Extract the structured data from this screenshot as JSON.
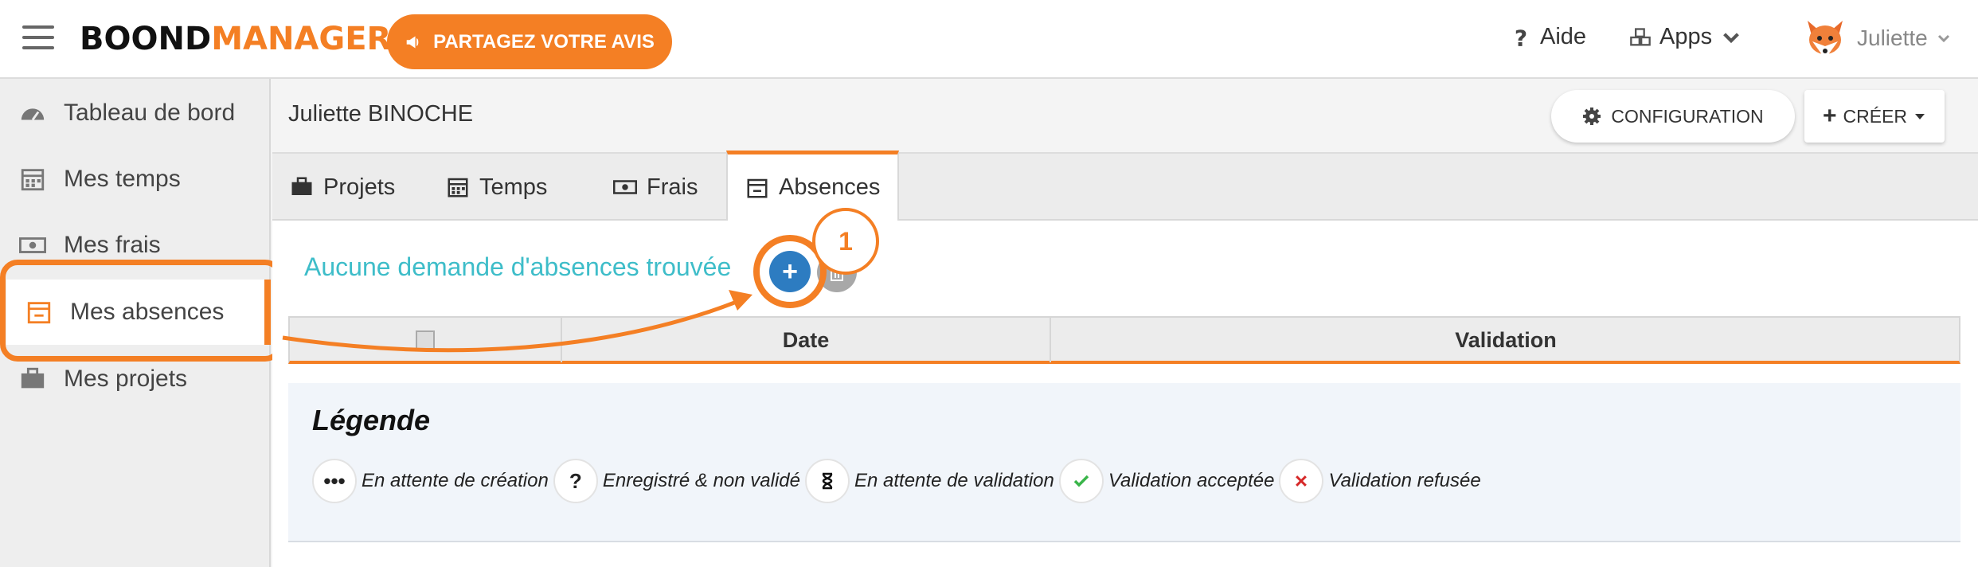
{
  "header": {
    "logo_part1": "BOOND",
    "logo_part2": "MANAGER",
    "feedback_label": "PARTAGEZ VOTRE AVIS",
    "help_label": "Aide",
    "apps_label": "Apps",
    "user_name": "Juliette"
  },
  "sidebar": {
    "items": [
      {
        "label": "Tableau de bord",
        "icon": "dashboard-icon"
      },
      {
        "label": "Mes temps",
        "icon": "calendar-grid-icon"
      },
      {
        "label": "Mes frais",
        "icon": "money-icon"
      },
      {
        "label": "Mes absences",
        "icon": "calendar-minus-icon",
        "active": true
      },
      {
        "label": "Mes projets",
        "icon": "briefcase-icon"
      }
    ]
  },
  "page": {
    "person_name": "Juliette BINOCHE",
    "config_label": "CONFIGURATION",
    "create_label": "CRÉER"
  },
  "tabs": [
    {
      "label": "Projets"
    },
    {
      "label": "Temps"
    },
    {
      "label": "Frais"
    },
    {
      "label": "Absences",
      "active": true
    }
  ],
  "content": {
    "empty_message": "Aucune demande d'absences trouvée",
    "step_number": "1",
    "table_headers": {
      "date": "Date",
      "validation": "Validation"
    }
  },
  "legend": {
    "title": "Légende",
    "items": [
      {
        "icon": "•••",
        "label": "En attente de création"
      },
      {
        "icon": "?",
        "label": "Enregistré & non validé"
      },
      {
        "icon": "hourglass",
        "label": "En attente de validation"
      },
      {
        "icon": "check",
        "label": "Validation acceptée"
      },
      {
        "icon": "cross",
        "label": "Validation refusée"
      }
    ]
  },
  "colors": {
    "accent": "#f47f24",
    "primary_blue": "#2d7cc1",
    "teal_text": "#3ebdc9"
  }
}
